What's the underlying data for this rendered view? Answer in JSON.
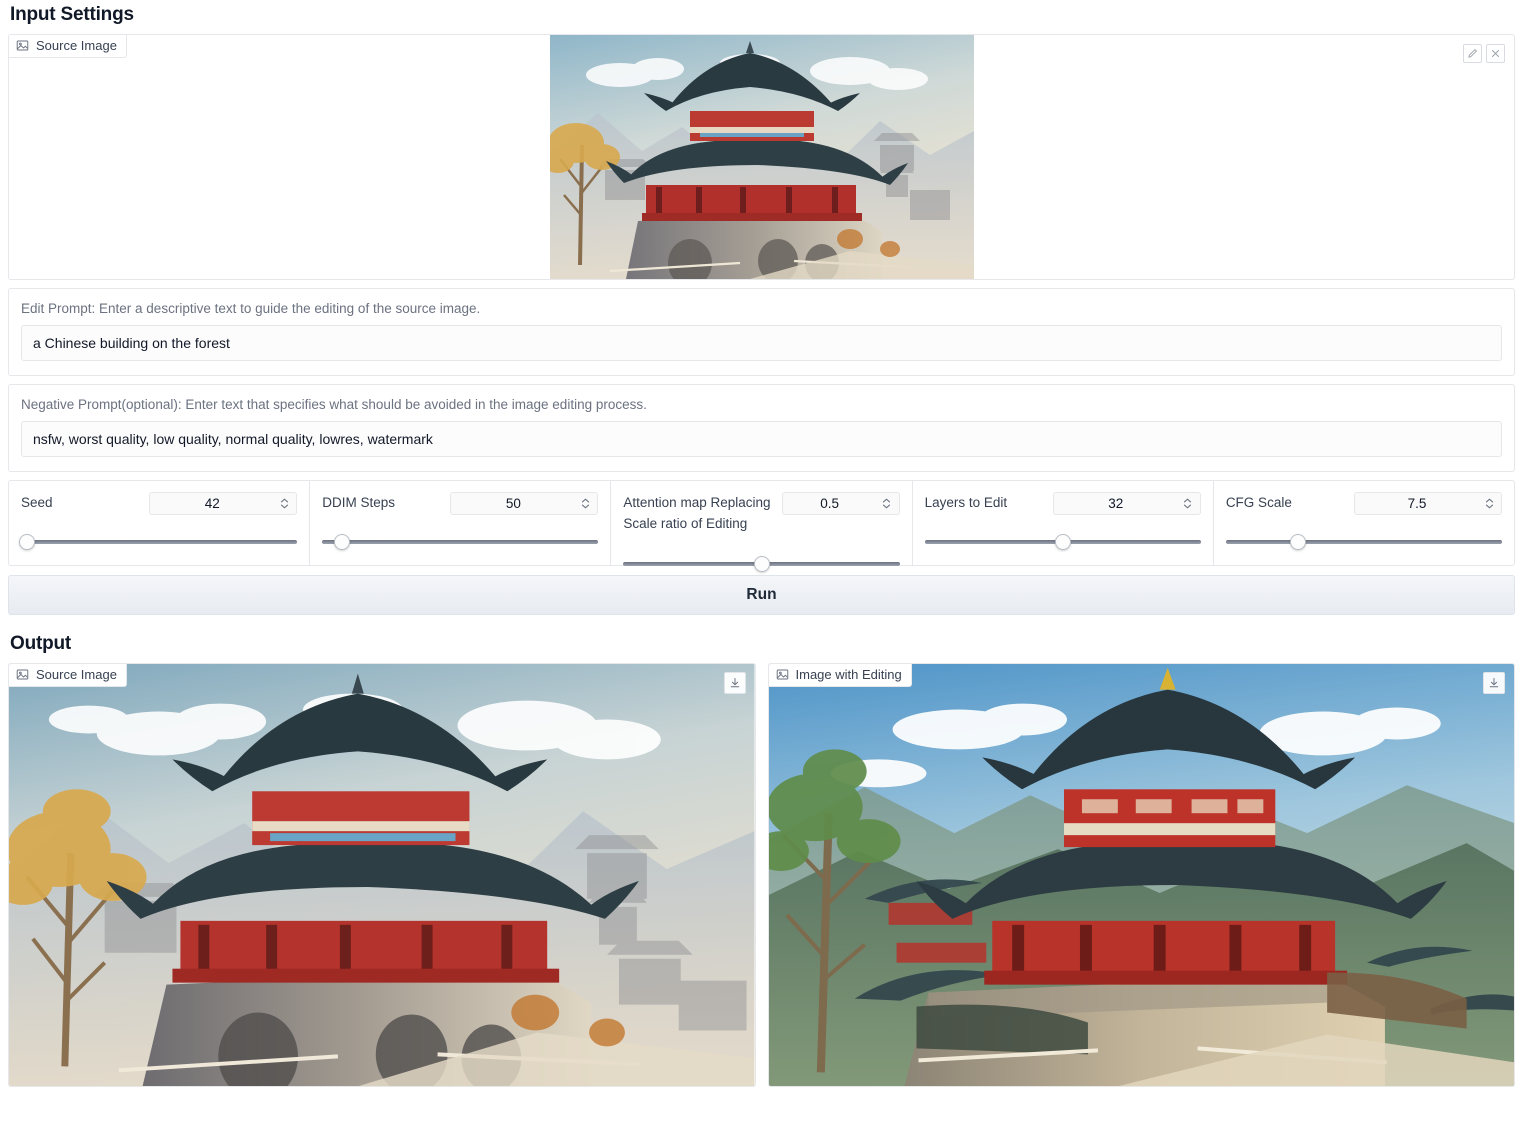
{
  "input_section": {
    "title": "Input Settings",
    "source_image": {
      "label": "Source Image",
      "icon": "image-icon",
      "edit_icon": "pencil-icon",
      "close_icon": "close-x-icon",
      "alt": "AI illustration of a multi-tiered Chinese pagoda temple with dark tiled roofs and red timber galleries on a stone bridge platform, misty mountains behind"
    },
    "edit_prompt": {
      "label": "Edit Prompt: Enter a descriptive text to guide the editing of the source image.",
      "value": "a Chinese building on the forest",
      "placeholder": ""
    },
    "negative_prompt": {
      "label": "Negative Prompt(optional): Enter text that specifies what should be avoided in the image editing process.",
      "value": "nsfw, worst quality, low quality, normal quality, lowres, watermark",
      "placeholder": ""
    },
    "sliders": [
      {
        "name": "Seed",
        "value": "42",
        "fill_pct": 2,
        "two_line": false
      },
      {
        "name": "DDIM Steps",
        "value": "50",
        "fill_pct": 7,
        "two_line": false
      },
      {
        "name": "Attention map Replacing Scale ratio of Editing",
        "name_line1": "Attention map Replacing",
        "name_line2": "Scale ratio of Editing",
        "value": "0.5",
        "fill_pct": 50,
        "two_line": true
      },
      {
        "name": "Layers to Edit",
        "value": "32",
        "fill_pct": 50,
        "two_line": false
      },
      {
        "name": "CFG Scale",
        "value": "7.5",
        "fill_pct": 26,
        "two_line": false
      }
    ],
    "run_button": "Run"
  },
  "output_section": {
    "title": "Output",
    "panels": [
      {
        "label": "Source Image",
        "icon": "image-icon",
        "download_icon": "download-icon",
        "alt": "Original illustration: Chinese pagoda on a stone bridge with golden tree at left and hazy mountains"
      },
      {
        "label": "Image with Editing",
        "icon": "image-icon",
        "download_icon": "download-icon",
        "alt": "Edited result: same pagoda rendered amid a green forested mountain landscape with blue sky"
      }
    ]
  },
  "colors": {
    "page_bg": "#ffffff",
    "border": "#e5e7eb",
    "label_text": "#6b7280",
    "body_text": "#111827",
    "run_bg_top": "#f4f6f9",
    "run_bg_bottom": "#e8ebf1",
    "slider_track": "#6b7280"
  }
}
